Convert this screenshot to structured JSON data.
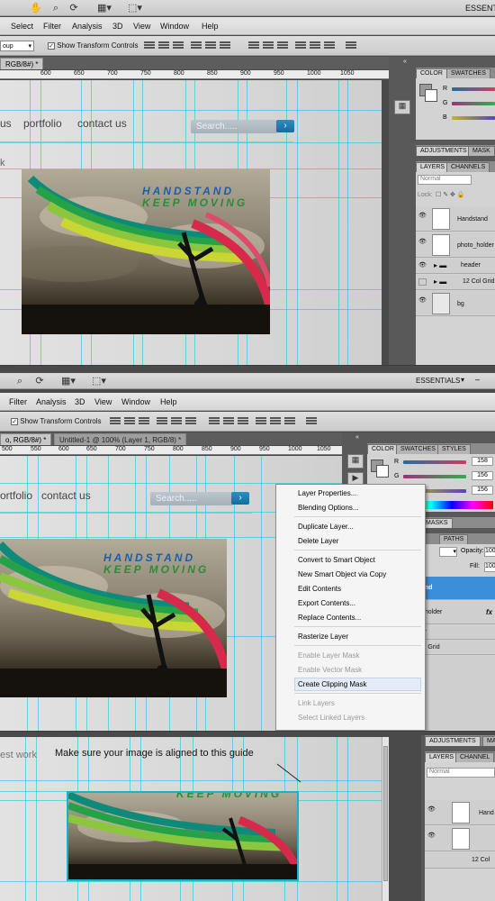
{
  "p1": {
    "toolbar_icons": [
      "hand-icon",
      "zoom-icon",
      "rotate-view-icon",
      "arrange-docs-icon",
      "screen-mode-icon"
    ],
    "workspace_label": "ESSENTIALS",
    "menu": [
      "Select",
      "Filter",
      "Analysis",
      "3D",
      "View",
      "Window",
      "Help"
    ],
    "options": {
      "group_label": "oup",
      "show_transform": "Show Transform Controls"
    },
    "tab_label": "RGB/8#) *",
    "ruler_labels": [
      "600",
      "650",
      "700",
      "750",
      "800",
      "850",
      "900",
      "950",
      "1000",
      "1050"
    ],
    "nav": [
      "us",
      "portfolio",
      "contact us"
    ],
    "search_placeholder": "Search.....",
    "search_button": "›",
    "side_letter": "k",
    "photo_line1": "HANDSTAND",
    "photo_line2": "KEEP MOVING",
    "color_tabs": [
      "COLOR",
      "SWATCHES"
    ],
    "channel_labels": [
      "R",
      "G",
      "B"
    ],
    "adj_tabs": [
      "ADJUSTMENTS",
      "MASK"
    ],
    "layer_tabs": [
      "LAYERS",
      "CHANNELS"
    ],
    "blend_mode": "Normal",
    "lock_label": "Lock:",
    "layers": [
      "Handstand",
      "photo_holder",
      "header",
      "12 Col Grid",
      "bg"
    ]
  },
  "p2": {
    "toolbar_icons": [
      "zoom-icon",
      "rotate-view-icon",
      "arrange-docs-icon",
      "screen-mode-icon"
    ],
    "workspace_label": "ESSENTIALS",
    "menu": [
      "Filter",
      "Analysis",
      "3D",
      "View",
      "Window",
      "Help"
    ],
    "show_transform": "Show Transform Controls",
    "tabs": [
      "o, RGB/8#) *",
      "Untitled-1 @ 100% (Layer 1, RGB/8) *"
    ],
    "ruler_labels": [
      "500",
      "550",
      "600",
      "650",
      "700",
      "750",
      "800",
      "850",
      "900",
      "950",
      "1000",
      "1050"
    ],
    "nav": [
      "ortfolio",
      "contact us"
    ],
    "search_placeholder": "Search.....",
    "search_button": "›",
    "photo_line1": "HANDSTAND",
    "photo_line2": "KEEP MOVING",
    "color_tabs": [
      "COLOR",
      "SWATCHES",
      "STYLES"
    ],
    "channel_labels": [
      "R",
      "G",
      "B"
    ],
    "channel_values": [
      "158",
      "156",
      "156"
    ],
    "masks_tab": "MASKS",
    "paths_tab": "PATHS",
    "opacity_label": "Opacity:",
    "opacity_value": "100",
    "fill_label": "Fill:",
    "fill_value": "100",
    "layer_rows": [
      "and",
      "_holder",
      "er",
      "ol Grid"
    ],
    "fx_label": "fx",
    "context_menu": [
      {
        "label": "Layer Properties...",
        "enabled": true
      },
      {
        "label": "Blending Options...",
        "enabled": true
      },
      {
        "sep": true
      },
      {
        "label": "Duplicate Layer...",
        "enabled": true
      },
      {
        "label": "Delete Layer",
        "enabled": true
      },
      {
        "sep": true
      },
      {
        "label": "Convert to Smart Object",
        "enabled": true
      },
      {
        "label": "New Smart Object via Copy",
        "enabled": true
      },
      {
        "label": "Edit Contents",
        "enabled": true
      },
      {
        "label": "Export Contents...",
        "enabled": true
      },
      {
        "label": "Replace Contents...",
        "enabled": true
      },
      {
        "sep": true
      },
      {
        "label": "Rasterize Layer",
        "enabled": true
      },
      {
        "sep": true
      },
      {
        "label": "Enable Layer Mask",
        "enabled": false
      },
      {
        "label": "Enable Vector Mask",
        "enabled": false
      },
      {
        "label": "Create Clipping Mask",
        "enabled": true,
        "highlight": true
      },
      {
        "sep": true
      },
      {
        "label": "Link Layers",
        "enabled": false
      },
      {
        "label": "Select Linked Layers",
        "enabled": false
      }
    ]
  },
  "p3": {
    "side_text": "est work",
    "note": "Make sure your image is aligned to this guide",
    "photo_line2": "KEEP MOVING",
    "adj_tabs": [
      "ADJUSTMENTS",
      "MA"
    ],
    "layer_tabs": [
      "LAYERS",
      "CHANNEL"
    ],
    "blend_mode": "Normal",
    "layer_rows": [
      "Hand",
      "",
      "12 Col"
    ]
  },
  "colors": {
    "guide": "#00c8dc",
    "accent": "#1f7fb5",
    "selection": "#3b8ed8"
  }
}
